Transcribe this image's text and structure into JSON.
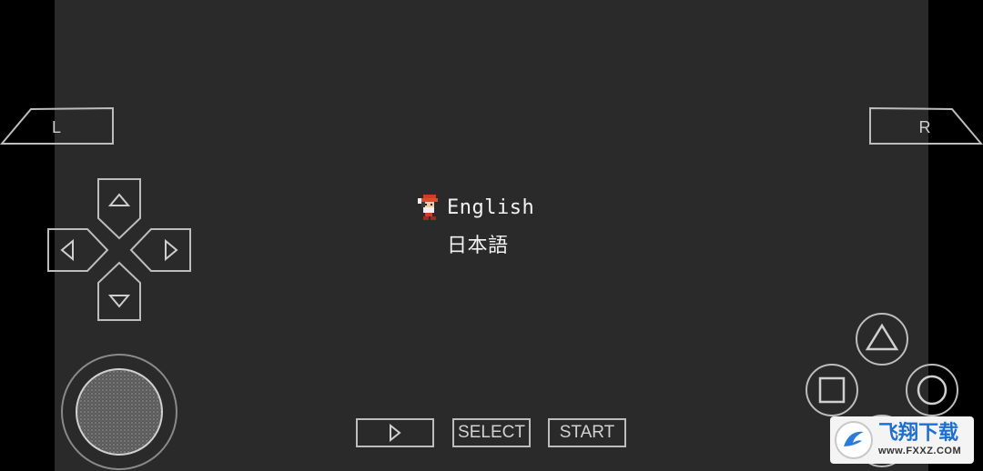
{
  "game": {
    "languages": [
      "English",
      "日本語"
    ],
    "selected_index": 0
  },
  "controls": {
    "shoulder_left": "L",
    "shoulder_right": "R",
    "select_label": "SELECT",
    "start_label": "START"
  },
  "watermark": {
    "text": "飞翔下载",
    "url": "www.FXXZ.COM"
  }
}
